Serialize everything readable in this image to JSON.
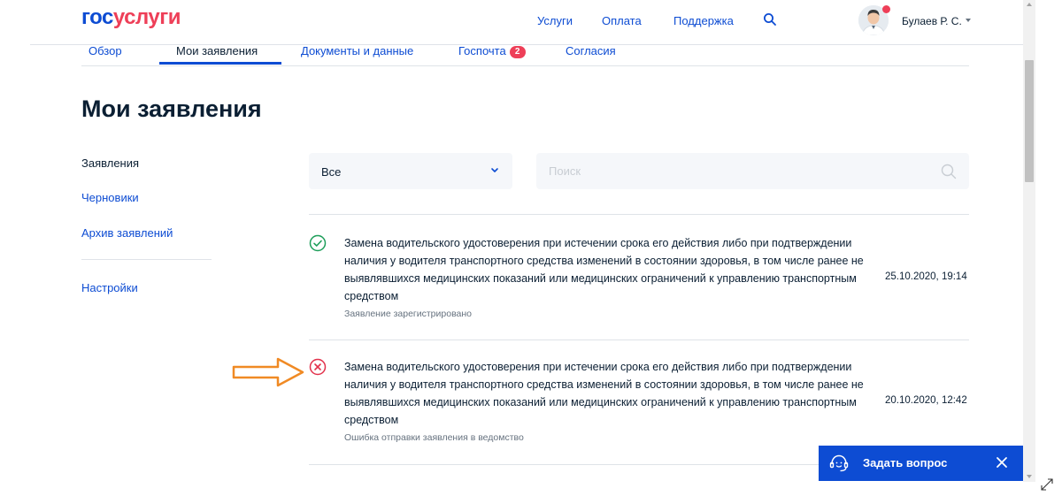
{
  "header": {
    "logo_part1": "гос",
    "logo_part2": "услуги",
    "nav": [
      {
        "label": "Услуги"
      },
      {
        "label": "Оплата"
      },
      {
        "label": "Поддержка"
      }
    ],
    "user_name": "Булаев Р. С."
  },
  "tabs": [
    {
      "label": "Обзор",
      "active": false
    },
    {
      "label": "Мои заявления",
      "active": true
    },
    {
      "label": "Документы и данные",
      "active": false
    },
    {
      "label": "Госпочта",
      "badge": "2",
      "active": false
    },
    {
      "label": "Согласия",
      "active": false
    }
  ],
  "page_title": "Мои заявления",
  "sidebar": {
    "items": [
      {
        "label": "Заявления",
        "active": true
      },
      {
        "label": "Черновики",
        "active": false
      },
      {
        "label": "Архив заявлений",
        "active": false
      },
      {
        "label": "Настройки",
        "active": false
      }
    ]
  },
  "filter": {
    "selected": "Все",
    "search_placeholder": "Поиск"
  },
  "applications": [
    {
      "title": "Замена водительского удостоверения при истечении срока его действия либо при подтверждении наличия у водителя транспортного средства изменений в состоянии здоровья, в том числе ранее не выявлявшихся медицинских показаний или медицинских ограничений к управлению транспортным средством",
      "status": "Заявление зарегистрировано",
      "date": "25.10.2020, 19:14",
      "state": "success",
      "icon": "check-circle-icon"
    },
    {
      "title": "Замена водительского удостоверения при истечении срока его действия либо при подтверждении наличия у водителя транспортного средства изменений в состоянии здоровья, в том числе ранее не выявлявшихся медицинских показаний или медицинских ограничений к управлению транспортным средством",
      "status": "Ошибка отправки заявления в ведомство",
      "date": "20.10.2020, 12:42",
      "state": "error",
      "icon": "error-circle-icon"
    }
  ],
  "help_widget": {
    "label": "Задать вопрос"
  },
  "colors": {
    "brand_blue": "#0d4cd3",
    "brand_red": "#ee3f58",
    "success": "#1e9e5a",
    "error": "#e2314b",
    "annotation_arrow": "#f08a24"
  }
}
